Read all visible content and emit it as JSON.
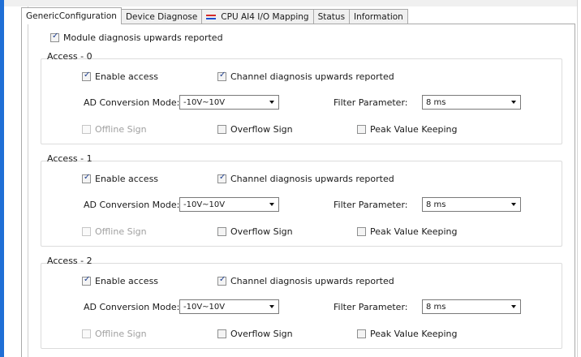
{
  "tabs": [
    "GenericConfiguration",
    "Device Diagnose",
    "CPU AI4 I/O Mapping",
    "Status",
    "Information"
  ],
  "module_diagnosis": {
    "label": "Module diagnosis upwards reported",
    "checked": true
  },
  "accesses": [
    {
      "title": "Access - 0",
      "enable_access": {
        "label": "Enable access",
        "checked": true
      },
      "channel_diag": {
        "label": "Channel diagnosis upwards reported",
        "checked": true
      },
      "ad_label": "AD Conversion Mode:",
      "ad_value": "-10V~10V",
      "filter_label": "Filter Parameter:",
      "filter_value": "8 ms",
      "offline_sign": {
        "label": "Offline Sign",
        "checked": false,
        "disabled": true
      },
      "overflow_sign": {
        "label": "Overflow Sign",
        "checked": false
      },
      "peak_value": {
        "label": "Peak Value Keeping",
        "checked": false
      }
    },
    {
      "title": "Access - 1",
      "enable_access": {
        "label": "Enable access",
        "checked": true
      },
      "channel_diag": {
        "label": "Channel diagnosis upwards reported",
        "checked": true
      },
      "ad_label": "AD Conversion Mode:",
      "ad_value": "-10V~10V",
      "filter_label": "Filter Parameter:",
      "filter_value": "8 ms",
      "offline_sign": {
        "label": "Offline Sign",
        "checked": false,
        "disabled": true
      },
      "overflow_sign": {
        "label": "Overflow Sign",
        "checked": false
      },
      "peak_value": {
        "label": "Peak Value Keeping",
        "checked": false
      }
    },
    {
      "title": "Access - 2",
      "enable_access": {
        "label": "Enable access",
        "checked": true
      },
      "channel_diag": {
        "label": "Channel diagnosis upwards reported",
        "checked": true
      },
      "ad_label": "AD Conversion Mode:",
      "ad_value": "-10V~10V",
      "filter_label": "Filter Parameter:",
      "filter_value": "8 ms",
      "offline_sign": {
        "label": "Offline Sign",
        "checked": false,
        "disabled": true
      },
      "overflow_sign": {
        "label": "Overflow Sign",
        "checked": false
      },
      "peak_value": {
        "label": "Peak Value Keeping",
        "checked": false
      }
    }
  ],
  "colors": {
    "accent": "#1f6fd6",
    "check": "#1e3f8f"
  }
}
